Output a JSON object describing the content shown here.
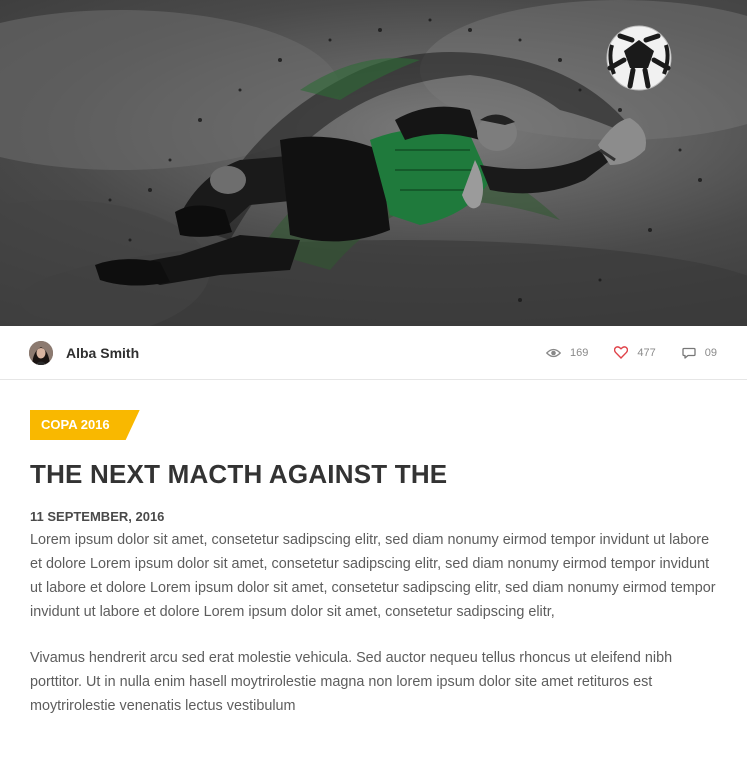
{
  "hero": {
    "image_icon": "goalkeeper-photo",
    "ball_icon": "soccer-ball-icon"
  },
  "author": {
    "name": "Alba Smith",
    "avatar_icon": "avatar-photo"
  },
  "stats": {
    "views": "169",
    "likes": "477",
    "comments": "09",
    "views_icon": "eye-icon",
    "likes_icon": "heart-icon",
    "comments_icon": "comment-icon",
    "like_color": "#e0434a"
  },
  "article": {
    "category": "COPA 2016",
    "category_color": "#f9b800",
    "title": "THE NEXT MACTH AGAINST THE",
    "date": "11 SEPTEMBER, 2016",
    "paragraphs": [
      "Lorem ipsum dolor sit amet, consetetur sadipscing elitr, sed diam nonumy eirmod tempor invidunt ut labore et dolore Lorem ipsum dolor sit amet, consetetur sadipscing elitr, sed diam nonumy eirmod tempor invidunt ut labore et dolore Lorem ipsum dolor sit amet, consetetur sadipscing elitr, sed diam nonumy eirmod tempor invidunt ut labore et dolore Lorem ipsum dolor sit amet, consetetur sadipscing elitr,",
      "Vivamus hendrerit arcu sed erat molestie vehicula. Sed auctor nequeu tellus rhoncus ut eleifend nibh porttitor. Ut in nulla enim hasell moytrirolestie magna non lorem ipsum dolor site amet retituros est moytrirolestie venenatis lectus vestibulum"
    ]
  }
}
